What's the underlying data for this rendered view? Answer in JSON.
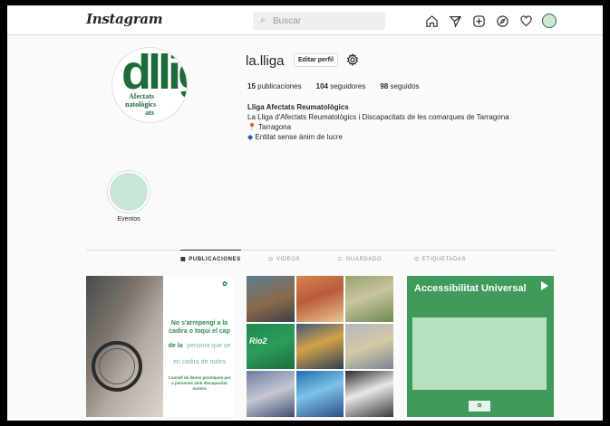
{
  "header": {
    "logo": "Instagram",
    "search_placeholder": "Buscar",
    "nav_icons": [
      "home-icon",
      "direct-icon",
      "new-post-icon",
      "explore-icon",
      "activity-icon",
      "avatar"
    ]
  },
  "profile": {
    "username": "la.lliga",
    "edit_label": "Editar perfil",
    "stats": {
      "posts_count": "15",
      "posts_label": "publicaciones",
      "followers_count": "104",
      "followers_label": "seguidores",
      "following_count": "98",
      "following_label": "seguidos"
    },
    "bio": {
      "name": "Lliga Afectats Reumatològics",
      "description": "La Lliga d'Afectats Reumatològics i Discapacitats de les comarques de Tarragona",
      "location_emoji": "📍",
      "location": "Tarragona",
      "nonprofit_emoji": "◆",
      "nonprofit": "Entitat sense ànim de lucre"
    },
    "avatar_text": {
      "big": "dllig",
      "sub": "Afectats\nnatològics\nats"
    }
  },
  "highlights": [
    {
      "label": "Eventos"
    }
  ],
  "tabs": [
    {
      "label": "PUBLICACIONES",
      "icon": "▦",
      "active": true
    },
    {
      "label": "VIDEOS",
      "icon": "◎",
      "active": false
    },
    {
      "label": "GUARDADO",
      "icon": "⊏",
      "active": false
    },
    {
      "label": "ETIQUETADAS",
      "icon": "⊡",
      "active": false
    }
  ],
  "posts": [
    {
      "line1": "No s'arrepengi a la cadira o toqui el cap",
      "line2_bold": "de la",
      "line2_rest": "persona que se en cadira de rodes",
      "small": "Consell de llenes pràctiques per a persones amb discapacitat motora"
    },
    {
      "cell_label": "Rio2"
    },
    {
      "title": "Accessibilitat Universal"
    }
  ]
}
